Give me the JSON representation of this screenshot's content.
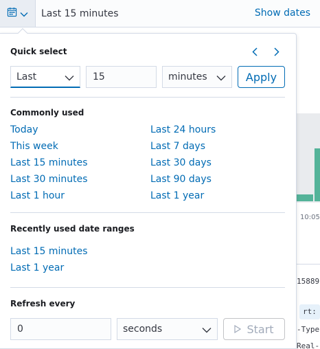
{
  "datebar": {
    "range_label": "Last 15 minutes",
    "show_dates_label": "Show dates",
    "icon": "calendar-icon"
  },
  "quick_select": {
    "title": "Quick select",
    "direction_value": "Last",
    "amount_value": "15",
    "unit_value": "minutes",
    "apply_label": "Apply"
  },
  "commonly_used": {
    "title": "Commonly used",
    "left": [
      "Today",
      "This week",
      "Last 15 minutes",
      "Last 30 minutes",
      "Last 1 hour"
    ],
    "right": [
      "Last 24 hours",
      "Last 7 days",
      "Last 30 days",
      "Last 90 days",
      "Last 1 year"
    ]
  },
  "recently_used": {
    "title": "Recently used date ranges",
    "items": [
      "Last 15 minutes",
      "Last 1 year"
    ]
  },
  "refresh": {
    "title": "Refresh every",
    "interval_value": "0",
    "unit_value": "seconds",
    "start_label": "Start"
  },
  "background": {
    "axis_time": "10:05:",
    "id_fragment": "15889(",
    "chip_text": "rt:",
    "line_a": "-Type",
    "line_b": "Real-"
  },
  "colors": {
    "link": "#006bb4",
    "border": "#d3dae6",
    "chart_bar": "#54b399",
    "chip_bg": "#e6f1fa"
  }
}
